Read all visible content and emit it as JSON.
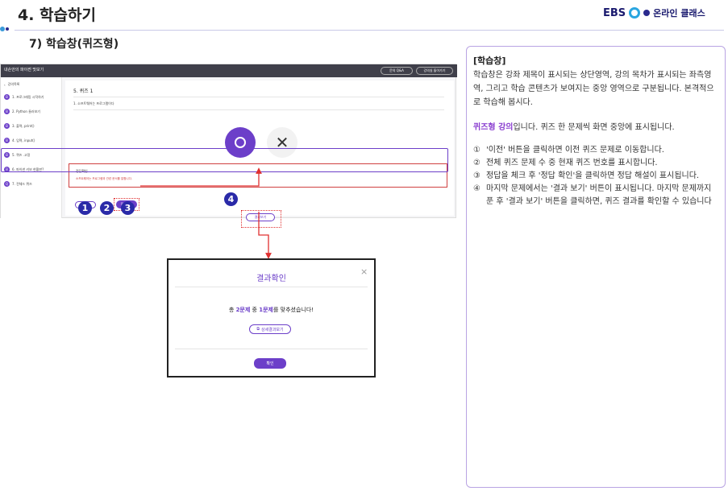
{
  "header": {
    "title": "4. 학습하기",
    "subtitle": "7) 학습창(퀴즈형)",
    "logo_ebs": "EBS",
    "logo_text": "온라인 클래스"
  },
  "lms": {
    "course_title": "내손안의 파이썬 맛보기",
    "top_buttons": [
      "문의 Q&A",
      "강의실 돌아가기"
    ],
    "back_label": "강의목록",
    "sidebar": [
      {
        "icon": "B",
        "label": "1. 프로그래밍 시작하기"
      },
      {
        "icon": "B",
        "label": "2. Python 둘러보기"
      },
      {
        "icon": "B",
        "label": "3. 출력, print()"
      },
      {
        "icon": "B",
        "label": "4. 입력, input()"
      },
      {
        "icon": "B",
        "label": "5. 퀴즈 .고정"
      },
      {
        "icon": "B",
        "label": "6. 파이썬 키보 현황판?"
      },
      {
        "icon": "Q",
        "label": "7. 전체드 퀴즈"
      }
    ],
    "quiz_title": "5. 퀴즈 1",
    "question": "1. 소프트웨어는 프로그램이다",
    "answer_label": "정답확인",
    "answer_text": "소프트웨어는 프로그램과 관련 문서를 말합니다.",
    "prev": "이전",
    "count": "1/2",
    "check": "정답확인",
    "result": "결과보기"
  },
  "markers": [
    "1",
    "2",
    "3",
    "4"
  ],
  "popup": {
    "title": "결과확인",
    "close": "×",
    "msg_prefix": "총 ",
    "total": "2문제",
    "msg_mid": " 중 ",
    "correct": "1문제",
    "msg_suffix": "를 맞추셨습니다!",
    "detail": "상세결과보기",
    "confirm": "확인"
  },
  "desc": {
    "heading": "[학습창]",
    "para1": "학습창은 강좌 제목이 표시되는 상단영역, 강의 목차가 표시되는 좌측영역, 그리고 학습 콘텐츠가 보여지는 중앙 영역으로 구분됩니다. 본격적으로 학습해 봅시다.",
    "para2_hl": "퀴즈형 강의",
    "para2": "입니다. 퀴즈 한 문제씩 화면 중앙에 표시됩니다.",
    "items": [
      {
        "n": "①",
        "t": "'이전' 버튼을 클릭하면 이전 퀴즈 문제로 이동합니다."
      },
      {
        "n": "②",
        "t": "전체 퀴즈 문제 수 중 현재 퀴즈 번호를 표시합니다."
      },
      {
        "n": "③",
        "t": "정답을 체크 후 '정답 확인'을 클릭하면 정답 해설이 표시됩니다."
      },
      {
        "n": "④",
        "t": "마지막 문제에서는 '결과 보기' 버튼이 표시됩니다. 마지막 문제까지 푼 후 '결과 보기' 버튼을 클릭하면, 퀴즈 결과를 확인할 수 있습니다"
      }
    ]
  },
  "colors": {
    "accent": "#6c3fc9",
    "highlight": "#e03030",
    "marker": "#2a2aa8"
  }
}
